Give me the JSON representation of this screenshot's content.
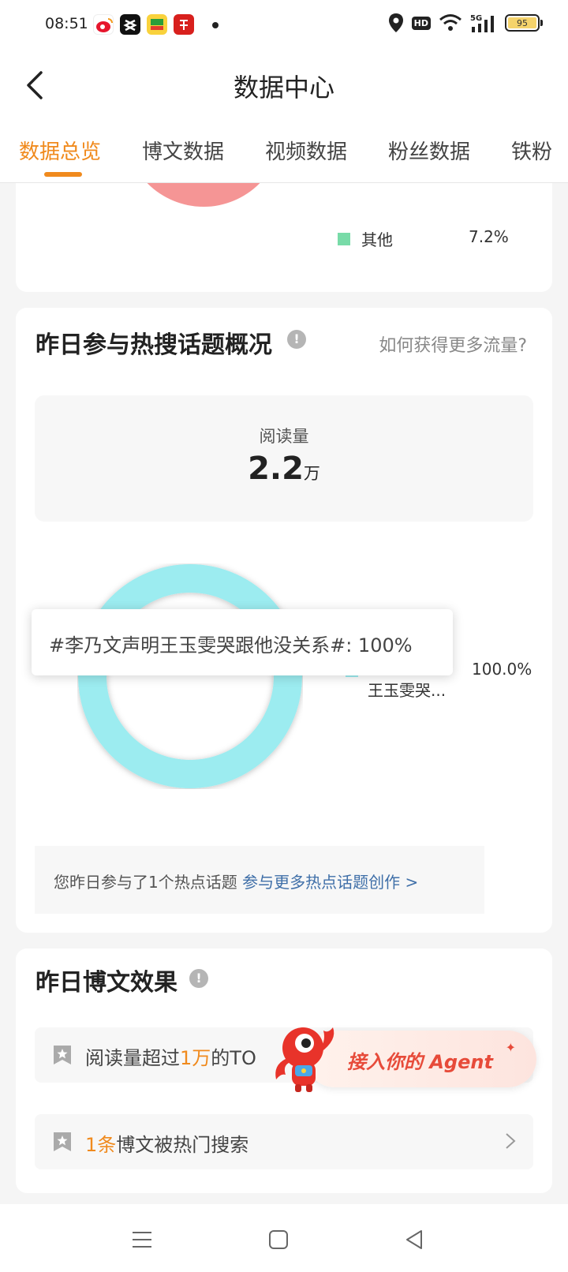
{
  "status_bar": {
    "time": "08:51",
    "apps": [
      "weibo-icon",
      "capcut-icon",
      "yellow-app-icon",
      "red-app-icon"
    ],
    "hd_label": "HD",
    "network": "5G",
    "battery": "95"
  },
  "header": {
    "title": "数据中心"
  },
  "tabs": [
    "数据总览",
    "博文数据",
    "视频数据",
    "粉丝数据",
    "铁粉"
  ],
  "active_tab": 0,
  "source_pie": {
    "legend": [
      {
        "label": "其他",
        "pct": "7.2%",
        "color": "#78dba8"
      }
    ],
    "fragment_color": "#f59595"
  },
  "hot_topics": {
    "title": "昨日参与热搜话题概况",
    "more_link": "如何获得更多流量?",
    "read_label": "阅读量",
    "read_value": "2.2",
    "read_unit": "万",
    "tooltip": "#李乃文声明王玉雯哭跟他没关系#: 100%",
    "legend_name": "#李乃文声明王玉雯哭...",
    "legend_name_visible": "王玉雯哭...",
    "legend_pct": "100.0%",
    "footer_text": "您昨日参与了1个热点话题",
    "footer_link": "参与更多热点话题创作 >"
  },
  "chart_data": {
    "type": "pie",
    "categories": [
      "#李乃文声明王玉雯哭跟他没关系#"
    ],
    "values": [
      100
    ],
    "colors": [
      "#9cecf0"
    ]
  },
  "post_effect": {
    "title": "昨日博文效果",
    "row1": {
      "prefix": "阅读量超过",
      "highlight": "1万",
      "suffix": "的TO"
    },
    "row2": {
      "highlight": "1条",
      "suffix": "博文被热门搜索"
    }
  },
  "agent_banner": {
    "label": "接入你的 Agent"
  }
}
